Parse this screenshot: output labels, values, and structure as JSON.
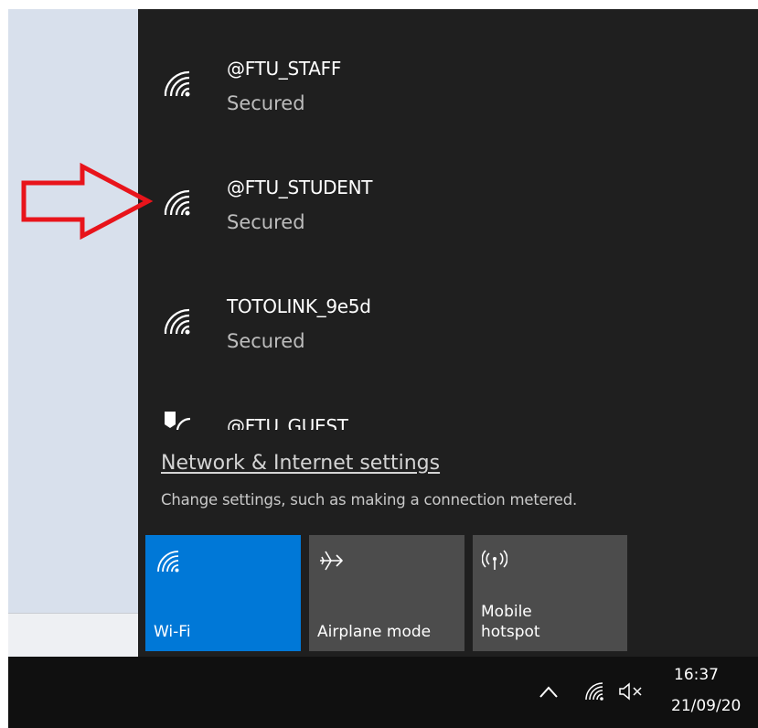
{
  "networks": [
    {
      "name": "@FTU_STAFF",
      "status": "Secured"
    },
    {
      "name": "@FTU_STUDENT",
      "status": "Secured"
    },
    {
      "name": "TOTOLINK_9e5d",
      "status": "Secured"
    },
    {
      "name": "@FTU_GUEST",
      "status": ""
    }
  ],
  "settings": {
    "link": "Network & Internet settings",
    "description": "Change settings, such as making a connection metered."
  },
  "quick_actions": [
    {
      "label": "Wi-Fi",
      "icon": "wifi-icon",
      "active": true
    },
    {
      "label": "Airplane mode",
      "icon": "airplane-icon",
      "active": false
    },
    {
      "label": "Mobile\nhotspot",
      "icon": "hotspot-icon",
      "active": false
    }
  ],
  "taskbar": {
    "time": "16:37",
    "date": "21/09/20",
    "tray_icons": [
      "chevron-up-icon",
      "wifi-icon",
      "speaker-muted-icon"
    ]
  },
  "colors": {
    "flyout_bg": "#1f1f1f",
    "accent": "#0078d7",
    "tile_bg": "#4c4c4c",
    "annotation_arrow": "#e8141b"
  }
}
